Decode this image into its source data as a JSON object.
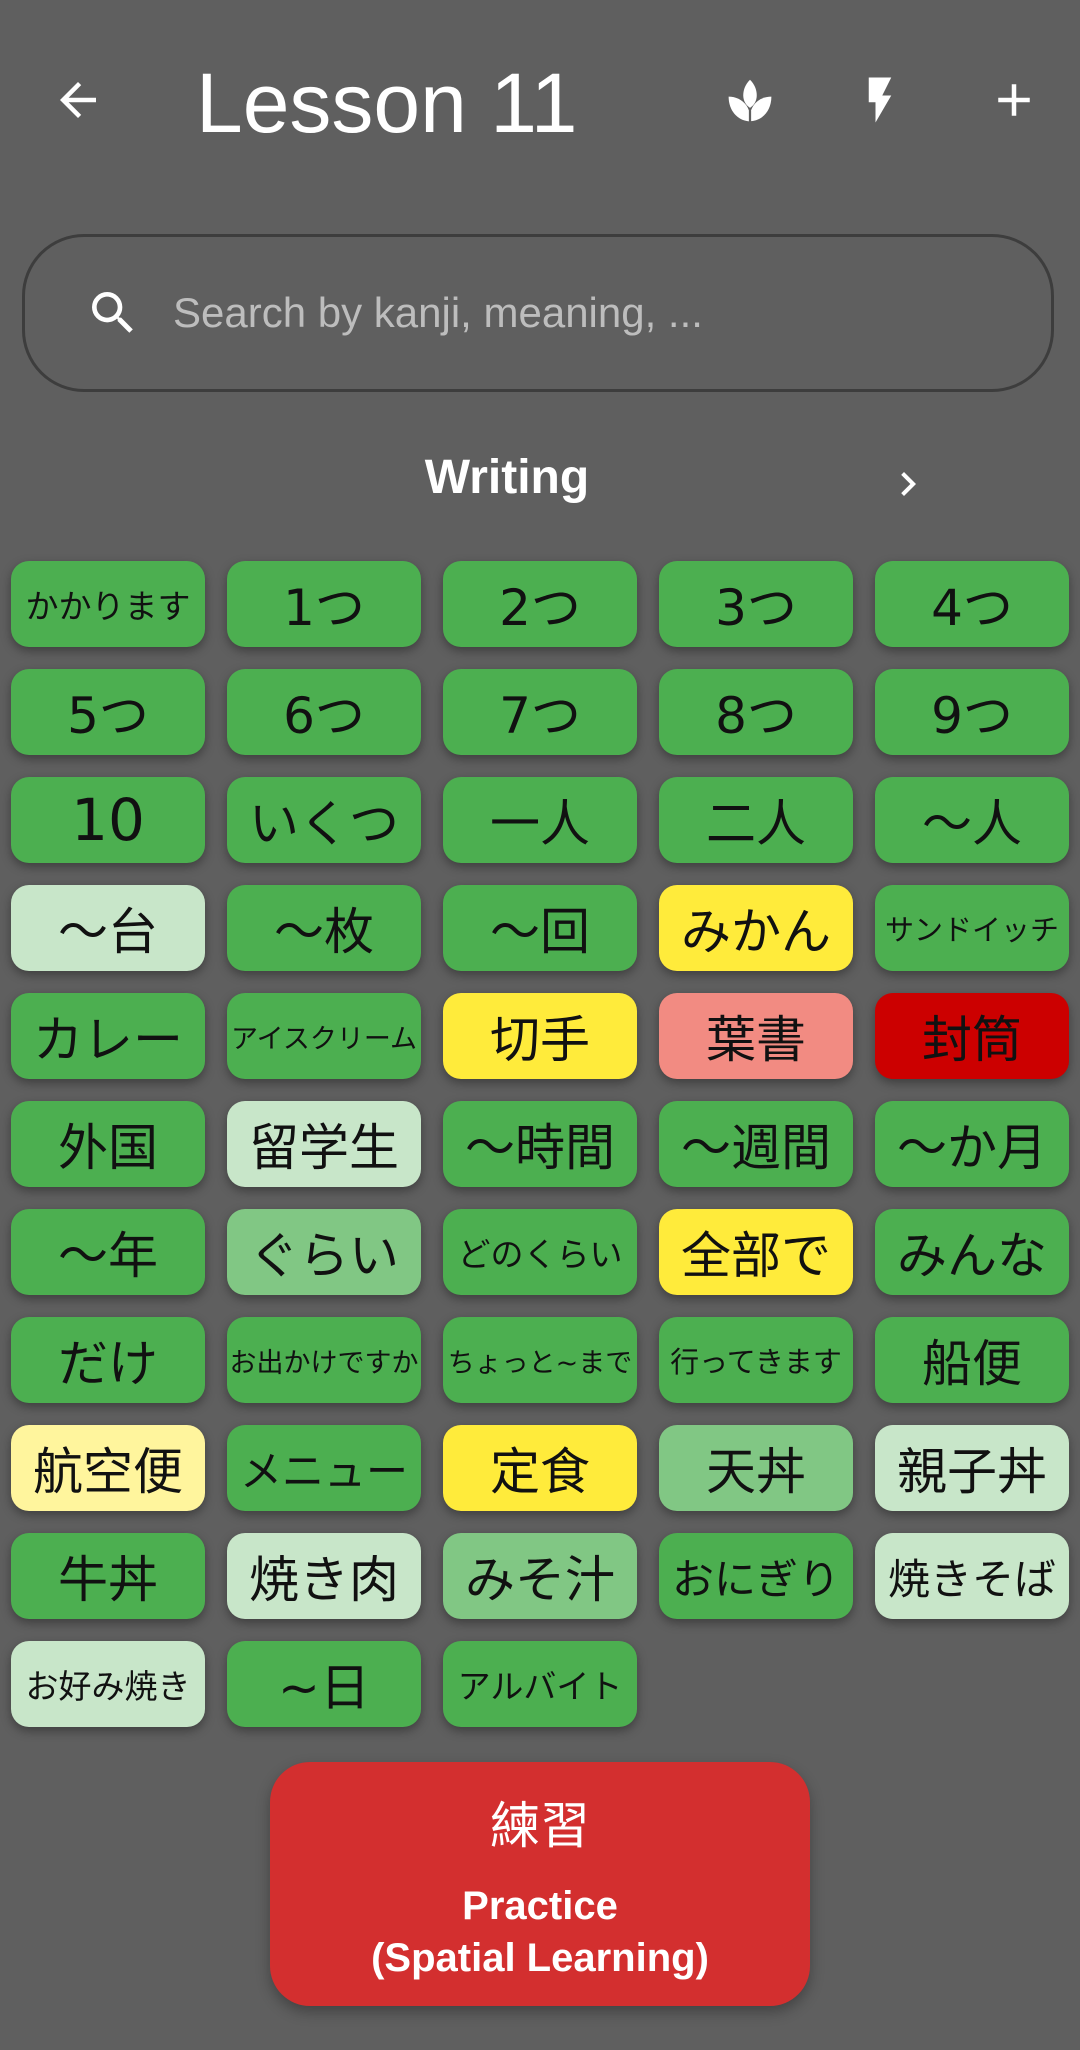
{
  "header": {
    "title": "Lesson 11",
    "icons": [
      "back-arrow-icon",
      "lotus-icon",
      "flash-icon",
      "plus-icon"
    ]
  },
  "search": {
    "placeholder": "Search by kanji, meaning, ..."
  },
  "section": {
    "title": "Writing"
  },
  "colors": {
    "green": "#4caf50",
    "mid_green": "#81c784",
    "light_green": "#c8e6c9",
    "yellow": "#ffeb3b",
    "light_yellow": "#fff59d",
    "salmon": "#f28b82",
    "red": "#cc0000",
    "practice_red": "#d32f2f"
  },
  "tiles": [
    {
      "text": "かかります",
      "color": "green"
    },
    {
      "text": "1つ",
      "color": "green"
    },
    {
      "text": "2つ",
      "color": "green"
    },
    {
      "text": "3つ",
      "color": "green"
    },
    {
      "text": "4つ",
      "color": "green"
    },
    {
      "text": "5つ",
      "color": "green"
    },
    {
      "text": "6つ",
      "color": "green"
    },
    {
      "text": "7つ",
      "color": "green"
    },
    {
      "text": "8つ",
      "color": "green"
    },
    {
      "text": "9つ",
      "color": "green"
    },
    {
      "text": "10",
      "color": "green"
    },
    {
      "text": "いくつ",
      "color": "green"
    },
    {
      "text": "一人",
      "color": "green"
    },
    {
      "text": "二人",
      "color": "green"
    },
    {
      "text": "～人",
      "color": "green"
    },
    {
      "text": "～台",
      "color": "light_green"
    },
    {
      "text": "～枚",
      "color": "green"
    },
    {
      "text": "～回",
      "color": "green"
    },
    {
      "text": "みかん",
      "color": "yellow"
    },
    {
      "text": "サンドイッチ",
      "color": "green"
    },
    {
      "text": "カレー",
      "color": "green"
    },
    {
      "text": "アイスクリーム",
      "color": "green"
    },
    {
      "text": "切手",
      "color": "yellow"
    },
    {
      "text": "葉書",
      "color": "salmon"
    },
    {
      "text": "封筒",
      "color": "red"
    },
    {
      "text": "外国",
      "color": "green"
    },
    {
      "text": "留学生",
      "color": "light_green"
    },
    {
      "text": "～時間",
      "color": "green"
    },
    {
      "text": "～週間",
      "color": "green"
    },
    {
      "text": "～か月",
      "color": "green"
    },
    {
      "text": "～年",
      "color": "green"
    },
    {
      "text": "ぐらい",
      "color": "mid_green"
    },
    {
      "text": "どのくらい",
      "color": "green"
    },
    {
      "text": "全部で",
      "color": "yellow"
    },
    {
      "text": "みんな",
      "color": "green"
    },
    {
      "text": "だけ",
      "color": "green"
    },
    {
      "text": "お出かけですか",
      "color": "green"
    },
    {
      "text": "ちょっと~まで",
      "color": "green"
    },
    {
      "text": "行ってきます",
      "color": "green"
    },
    {
      "text": "船便",
      "color": "green"
    },
    {
      "text": "航空便",
      "color": "light_yellow"
    },
    {
      "text": "メニュー",
      "color": "green"
    },
    {
      "text": "定食",
      "color": "yellow"
    },
    {
      "text": "天丼",
      "color": "mid_green"
    },
    {
      "text": "親子丼",
      "color": "light_green"
    },
    {
      "text": "牛丼",
      "color": "green"
    },
    {
      "text": "焼き肉",
      "color": "light_green"
    },
    {
      "text": "みそ汁",
      "color": "mid_green"
    },
    {
      "text": "おにぎり",
      "color": "green"
    },
    {
      "text": "焼きそば",
      "color": "light_green"
    },
    {
      "text": "お好み焼き",
      "color": "light_green"
    },
    {
      "text": "~日",
      "color": "green"
    },
    {
      "text": "アルバイト",
      "color": "green"
    }
  ],
  "practice": {
    "jp": "練習",
    "line1": "Practice",
    "line2": "(Spatial Learning)"
  }
}
